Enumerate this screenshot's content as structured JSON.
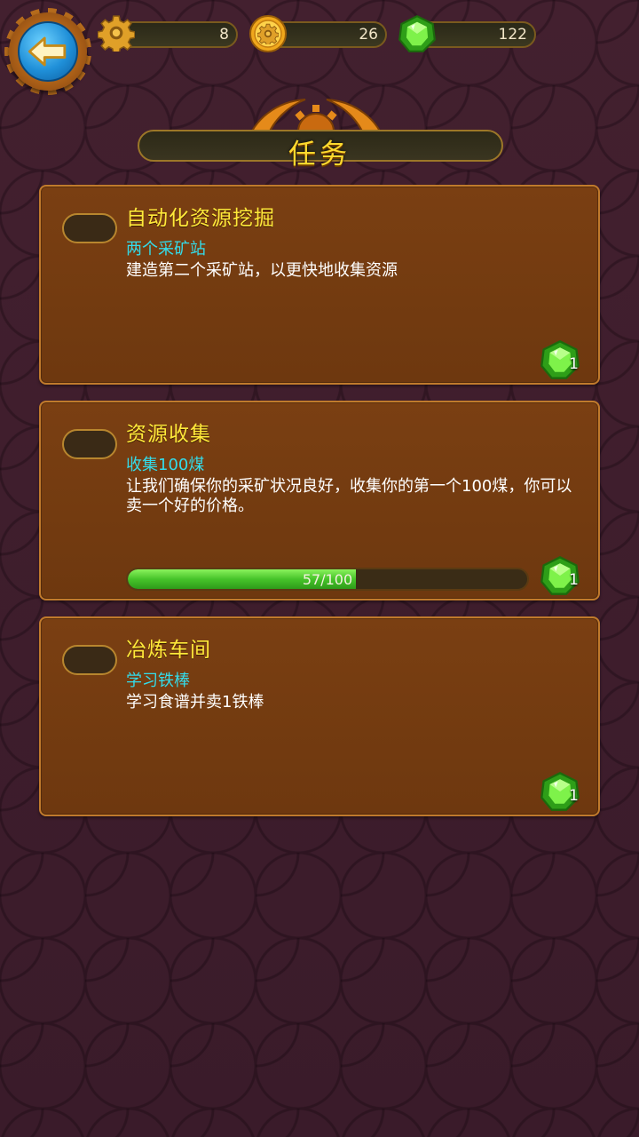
{
  "header": {
    "resources": [
      {
        "icon": "gear-icon",
        "value": "8"
      },
      {
        "icon": "gold-coin-icon",
        "value": "26"
      },
      {
        "icon": "green-gem-icon",
        "value": "122"
      }
    ]
  },
  "title": "任务",
  "quests": [
    {
      "title": "自动化资源挖掘",
      "subtitle": "两个采矿站",
      "description": "建造第二个采矿站，以更快地收集资源",
      "reward_icon": "green-gem-icon",
      "reward_count": "1"
    },
    {
      "title": "资源收集",
      "subtitle": "收集100煤",
      "description": "让我们确保你的采矿状况良好，收集你的第一个100煤，你可以卖一个好的价格。",
      "progress_text": "57/100",
      "progress_fraction": 0.57,
      "reward_icon": "green-gem-icon",
      "reward_count": "1"
    },
    {
      "title": "冶炼车间",
      "subtitle": "学习铁棒",
      "description": "学习食谱并卖1铁棒",
      "reward_icon": "green-gem-icon",
      "reward_count": "1"
    }
  ],
  "colors": {
    "title": "#ffd92e",
    "quest_title": "#ffe93a",
    "quest_subtitle": "#33dceb",
    "progress_fill": "#46c42a"
  }
}
